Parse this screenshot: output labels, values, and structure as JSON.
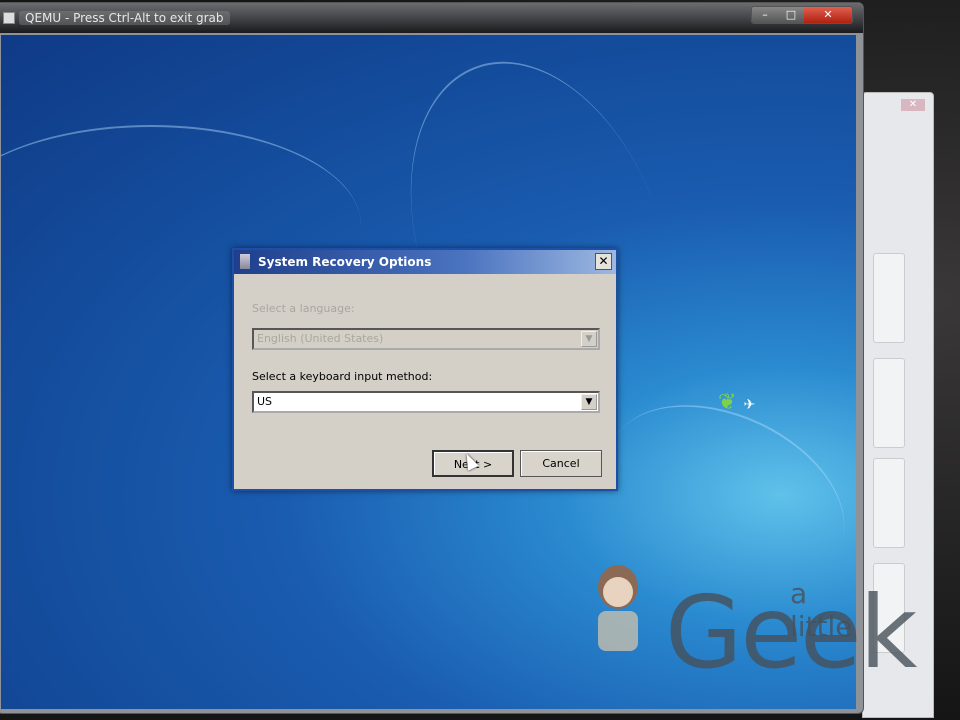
{
  "window": {
    "title": "QEMU - Press Ctrl-Alt to exit grab",
    "minimize": "–",
    "maximize": "□",
    "close": "✕"
  },
  "background_window": {
    "close": "✕"
  },
  "dialog": {
    "title": "System Recovery Options",
    "close": "✕",
    "language_label": "Select a language:",
    "language_value": "English (United States)",
    "keyboard_label": "Select a keyboard input method:",
    "keyboard_value": "US",
    "next_button": "Next >",
    "cancel_button": "Cancel",
    "dropdown_arrow": "▼"
  },
  "watermark": {
    "small": "a little",
    "big": "Geek"
  }
}
